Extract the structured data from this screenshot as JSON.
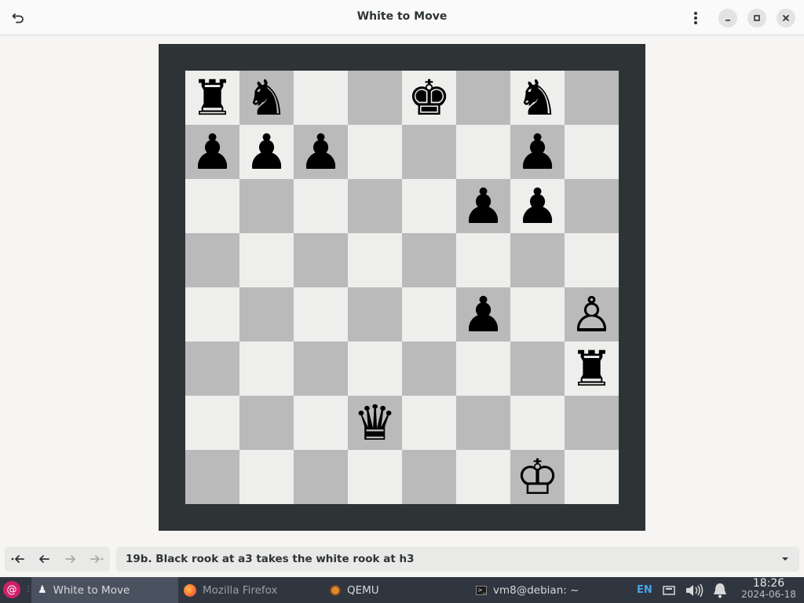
{
  "window": {
    "title": "White to Move"
  },
  "board": {
    "rows": [
      [
        "♜",
        "♞",
        "",
        "",
        "♚",
        "",
        "♞",
        ""
      ],
      [
        "♟",
        "♟",
        "♟",
        "",
        "",
        "",
        "♟",
        ""
      ],
      [
        "",
        "",
        "",
        "",
        "",
        "♟",
        "♟",
        ""
      ],
      [
        "",
        "",
        "",
        "",
        "",
        "",
        "",
        ""
      ],
      [
        "",
        "",
        "",
        "",
        "",
        "♟",
        "",
        "♙"
      ],
      [
        "",
        "",
        "",
        "",
        "",
        "",
        "",
        "♜"
      ],
      [
        "",
        "",
        "",
        "♛",
        "",
        "",
        "",
        ""
      ],
      [
        "",
        "",
        "",
        "",
        "",
        "",
        "♔",
        ""
      ]
    ],
    "colors": {
      "light": "#eeeeec",
      "dark": "#bababa",
      "frame": "#2e3436"
    }
  },
  "history": {
    "current_move": "19b. Black rook at a3 takes the white rook at h3"
  },
  "taskbar": {
    "tasks": [
      {
        "label": "White to Move",
        "icon": "chess-pawn-icon"
      },
      {
        "label": "Mozilla Firefox",
        "icon": "firefox-icon"
      },
      {
        "label": "QEMU",
        "icon": "qemu-icon"
      },
      {
        "label": "vm8@debian: ~",
        "icon": "terminal-icon"
      }
    ],
    "keyboard_layout": "EN",
    "time": "18:26",
    "date": "2024-06-18"
  }
}
